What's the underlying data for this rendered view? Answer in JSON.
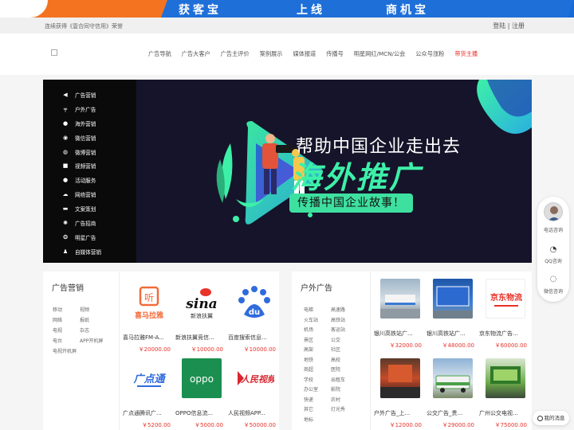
{
  "banner": {
    "slogan_1": "获客宝",
    "slogan_2": "上线",
    "slogan_3": "商机宝"
  },
  "topbar": {
    "notice": "连续获得《壹合同守信用》荣誉",
    "login": "登陆",
    "sep": " | ",
    "register": "注册"
  },
  "nav": {
    "items": [
      "广告导航",
      "广告大客户",
      "广告主评价",
      "案例展示",
      "媒体报道",
      "传播号",
      "明星网红/MCN/公会",
      "公众号涨粉",
      "带货主播"
    ]
  },
  "categories": [
    {
      "label": "广告营销",
      "icon": "megaphone-icon"
    },
    {
      "label": "户外广告",
      "icon": "signpost-icon"
    },
    {
      "label": "海外营销",
      "icon": "globe-icon"
    },
    {
      "label": "微信营销",
      "icon": "wechat-icon"
    },
    {
      "label": "微博营销",
      "icon": "weibo-icon"
    },
    {
      "label": "视频营销",
      "icon": "video-icon"
    },
    {
      "label": "活动服务",
      "icon": "circle-icon"
    },
    {
      "label": "网络营销",
      "icon": "cloud-icon"
    },
    {
      "label": "文案策划",
      "icon": "briefcase-icon"
    },
    {
      "label": "广告招商",
      "icon": "gear-icon"
    },
    {
      "label": "明星广告",
      "icon": "star-icon"
    },
    {
      "label": "自媒体营销",
      "icon": "person-icon"
    }
  ],
  "hero": {
    "title": "帮助中国企业走出去",
    "main": "海外推广",
    "sub": "传播中国企业故事！"
  },
  "left_panel": {
    "title": "广告营销",
    "tags": [
      "移动",
      "视频",
      "网络",
      "报纸",
      "电视",
      "杂志",
      "电台",
      "APP开机屏",
      "电视开机屏"
    ],
    "cards": [
      {
        "name": "喜马拉雅FM-A...",
        "price": "￥20000.00",
        "logo": "喜马拉雅"
      },
      {
        "name": "新浪扶翼竞信...",
        "price": "￥10000.00",
        "logo": "新浪扶翼"
      },
      {
        "name": "百度搜索信息...",
        "price": "￥10000.00",
        "logo": "du"
      },
      {
        "name": "广点通腾讯广...",
        "price": "￥5200.00",
        "logo": "广点通"
      },
      {
        "name": "OPPO信息流...",
        "price": "￥5000.00",
        "logo": "oppo"
      },
      {
        "name": "人民视频APP...",
        "price": "￥50000.00",
        "logo": "人民视频"
      }
    ]
  },
  "right_panel": {
    "title": "户外广告",
    "tags": [
      "电梯",
      "高速路",
      "火车站",
      "高铁站",
      "机场",
      "客运站",
      "景区",
      "公交",
      "高架",
      "社区",
      "地铁",
      "高校",
      "商超",
      "医院",
      "学校",
      "出租车",
      "办公室",
      "影院",
      "快递",
      "农村",
      "其它",
      "灯光秀",
      "地标"
    ],
    "cards": [
      {
        "name": "银川高铁站广...",
        "price": "￥32000.00"
      },
      {
        "name": "银川高铁站广...",
        "price": "￥48000.00"
      },
      {
        "name": "京东物流广告...",
        "price": "￥60000.00",
        "logo": "京东物流"
      },
      {
        "name": "户外广告_上...",
        "price": "￥12000.00"
      },
      {
        "name": "公交广告_贵...",
        "price": "￥29000.00"
      },
      {
        "name": "广州公交电视...",
        "price": "￥75000.00"
      }
    ]
  },
  "float": {
    "phone": "电话咨询",
    "qq": "QQ咨询",
    "wechat": "微信咨询",
    "message": "我的消息"
  },
  "colors": {
    "accent_red": "#e8322a",
    "brand_green": "#3df0a8",
    "banner_orange": "#f37321",
    "banner_blue": "#1f6fd8"
  }
}
